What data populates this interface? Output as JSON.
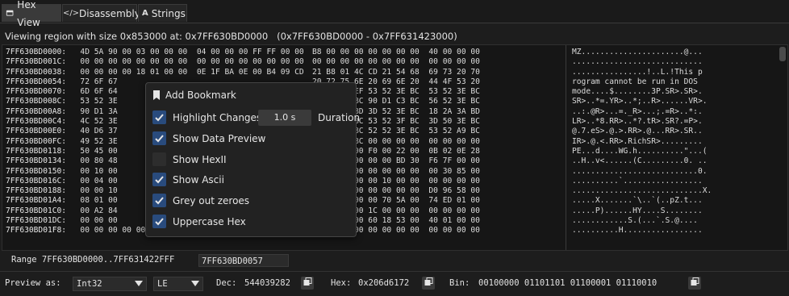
{
  "tabs": [
    {
      "label": "Hex View",
      "icon": "hex-view-icon"
    },
    {
      "label": "Disassembly",
      "icon": "code-icon"
    },
    {
      "label": "Strings",
      "icon": "strings-icon"
    }
  ],
  "region_text": "Viewing region with size 0x853000 at: 0x7FF630BD0000   (0x7FF630BD0000 - 0x7FF631423000)",
  "hex_rows": [
    {
      "addr": "7FF630BD0000:",
      "left": "4D 5A 90 00 03 00 00 00  04 00 00 00 FF FF 00 00",
      "right": "B8 00 00 00 00 00 00 00  40 00 00 00",
      "ascii": "MZ......................@..."
    },
    {
      "addr": "7FF630BD001C:",
      "left": "00 00 00 00 00 00 00 00  00 00 00 00 00 00 00 00",
      "right": "00 00 00 00 00 00 00 00  00 00 00 00",
      "ascii": "............................"
    },
    {
      "addr": "7FF630BD0038:",
      "left": "00 00 00 00 18 01 00 00  0E 1F BA 0E 00 B4 09 CD",
      "right": "21 B8 01 4C CD 21 54 68  69 73 20 70",
      "ascii": "................!..L.!This p"
    },
    {
      "addr": "7FF630BD0054:",
      "left": "72 6F 67",
      "right": "20 72 75 6E 20 69 6E 20  44 4F 53 20",
      "ascii": "rogram cannot be run in DOS "
    },
    {
      "addr": "7FF630BD0070:",
      "left": "6D 6F 64",
      "right": "17 33 50 EF 53 52 3E BC  53 52 3E BC",
      "ascii": "mode....$........3P.SR>.SR>."
    },
    {
      "addr": "7FF630BD008C:",
      "left": "53 52 3E",
      "right": "93 52 3E BC 90 D1 C3 BC  56 52 3E BC",
      "ascii": "SR>..*=.YR>..*;..R>......VR>."
    },
    {
      "addr": "7FF630BD00A8:",
      "left": "90 D1 3A",
      "right": "90 D1 3B BD 3D 52 3E BC  18 2A 3A BD",
      "ascii": "..:.@R>...=._R>...;.=R>..*:."
    },
    {
      "addr": "7FF630BD00C4:",
      "left": "4C 52 3E",
      "right": "74 52 3E BC 53 52 3F BC  3D 50 3E BC",
      "ascii": "LR>..*8.RR>..*?.tR>.SR?.=P>."
    },
    {
      "addr": "7FF630BD00E0:",
      "left": "40 D6 37",
      "right": "40 D6 C1 BC 52 52 3E BC  53 52 A9 BC",
      "ascii": "@.7.eS>.@.>.RR>.@...RR>.SR.."
    },
    {
      "addr": "7FF630BD00FC:",
      "left": "49 52 3E",
      "right": "53 52 3E BC 00 00 00 00  00 00 00 00",
      "ascii": "IR>.@.<.RR>.RichSR>........."
    },
    {
      "addr": "7FF630BD0118:",
      "left": "50 45 00",
      "right": "00 00 00 00 F0 00 22 00  0B 02 0E 28",
      "ascii": "PE...d....WG.h..........\"...("
    },
    {
      "addr": "7FF630BD0134:",
      "left": "00 80 48",
      "right": "00 10 00 00 00 00 BD 30  F6 7F 00 00",
      "ascii": "..H..v<......(C.........0. .."
    },
    {
      "addr": "7FF630BD0150:",
      "left": "00 10 00",
      "right": "06 00 00 00 00 00 00 00  00 30 85 00",
      "ascii": "...........................0."
    },
    {
      "addr": "7FF630BD016C:",
      "left": "00 04 00",
      "right": "00 00 00 00 00 10 00 00  00 00 00 00",
      "ascii": "..........`................."
    },
    {
      "addr": "7FF630BD0188:",
      "left": "00 00 10",
      "right": "00 00 00 00 00 00 00 00  D0 96 58 00",
      "ascii": "............................X."
    },
    {
      "addr": "7FF630BD01A4:",
      "left": "08 01 00",
      "right": "A0 60 28 00 00 70 5A 00  74 ED 01 00",
      "ascii": ".....X.......`\\..`(..pZ.t..."
    },
    {
      "addr": "7FF630BD01C0:",
      "left": "00 A2 84",
      "right": "A0 19 53 00 1C 00 00 00  00 00 00 00",
      "ascii": ".....P)......HY....S........"
    },
    {
      "addr": "7FF630BD01DC:",
      "left": "00 00 00",
      "right": "28 00 00 00 60 18 53 00  40 01 00 00",
      "ascii": "............S.(...`.S.@...."
    },
    {
      "addr": "7FF630BD01F8:",
      "left": "00 00 00 00 00 00 00 00  00 00 90 48 00 E0 12 00",
      "right": "00 00 00 00 00 00 00 00  00 00 00 00",
      "ascii": "..........H................."
    }
  ],
  "popup": {
    "add_bookmark": "Add Bookmark",
    "highlight_changes": "Highlight Changes",
    "duration_value": "1.0 s",
    "duration_label": "Duration",
    "options": [
      {
        "label": "Show Data Preview",
        "checked": true
      },
      {
        "label": "Show HexII",
        "checked": false
      },
      {
        "label": "Show Ascii",
        "checked": true
      },
      {
        "label": "Grey out zeroes",
        "checked": true
      },
      {
        "label": "Uppercase Hex",
        "checked": true
      }
    ]
  },
  "range": {
    "label": "Range 7FF630BD0000..7FF631422FFF",
    "value": "7FF630BD0057"
  },
  "preview": {
    "label": "Preview as:",
    "type": "Int32",
    "endian": "LE",
    "dec_label": "Dec:",
    "dec_value": "544039282",
    "hex_label": "Hex:",
    "hex_value": "0x206d6172",
    "bin_label": "Bin:",
    "bin_value": "00100000 01101101 01100001 01110010"
  }
}
